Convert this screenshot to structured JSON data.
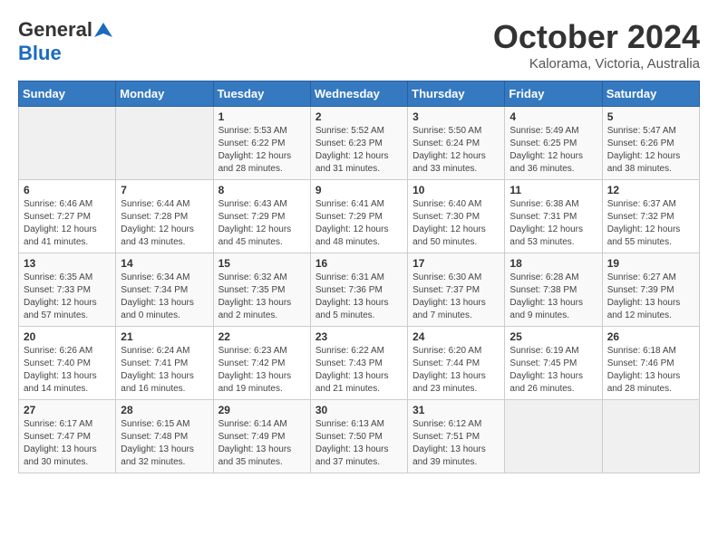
{
  "header": {
    "logo_general": "General",
    "logo_blue": "Blue",
    "month": "October 2024",
    "location": "Kalorama, Victoria, Australia"
  },
  "columns": [
    "Sunday",
    "Monday",
    "Tuesday",
    "Wednesday",
    "Thursday",
    "Friday",
    "Saturday"
  ],
  "weeks": [
    [
      {
        "day": "",
        "empty": true
      },
      {
        "day": "",
        "empty": true
      },
      {
        "day": "1",
        "sunrise": "5:53 AM",
        "sunset": "6:22 PM",
        "daylight": "12 hours and 28 minutes."
      },
      {
        "day": "2",
        "sunrise": "5:52 AM",
        "sunset": "6:23 PM",
        "daylight": "12 hours and 31 minutes."
      },
      {
        "day": "3",
        "sunrise": "5:50 AM",
        "sunset": "6:24 PM",
        "daylight": "12 hours and 33 minutes."
      },
      {
        "day": "4",
        "sunrise": "5:49 AM",
        "sunset": "6:25 PM",
        "daylight": "12 hours and 36 minutes."
      },
      {
        "day": "5",
        "sunrise": "5:47 AM",
        "sunset": "6:26 PM",
        "daylight": "12 hours and 38 minutes."
      }
    ],
    [
      {
        "day": "6",
        "sunrise": "6:46 AM",
        "sunset": "7:27 PM",
        "daylight": "12 hours and 41 minutes."
      },
      {
        "day": "7",
        "sunrise": "6:44 AM",
        "sunset": "7:28 PM",
        "daylight": "12 hours and 43 minutes."
      },
      {
        "day": "8",
        "sunrise": "6:43 AM",
        "sunset": "7:29 PM",
        "daylight": "12 hours and 45 minutes."
      },
      {
        "day": "9",
        "sunrise": "6:41 AM",
        "sunset": "7:29 PM",
        "daylight": "12 hours and 48 minutes."
      },
      {
        "day": "10",
        "sunrise": "6:40 AM",
        "sunset": "7:30 PM",
        "daylight": "12 hours and 50 minutes."
      },
      {
        "day": "11",
        "sunrise": "6:38 AM",
        "sunset": "7:31 PM",
        "daylight": "12 hours and 53 minutes."
      },
      {
        "day": "12",
        "sunrise": "6:37 AM",
        "sunset": "7:32 PM",
        "daylight": "12 hours and 55 minutes."
      }
    ],
    [
      {
        "day": "13",
        "sunrise": "6:35 AM",
        "sunset": "7:33 PM",
        "daylight": "12 hours and 57 minutes."
      },
      {
        "day": "14",
        "sunrise": "6:34 AM",
        "sunset": "7:34 PM",
        "daylight": "13 hours and 0 minutes."
      },
      {
        "day": "15",
        "sunrise": "6:32 AM",
        "sunset": "7:35 PM",
        "daylight": "13 hours and 2 minutes."
      },
      {
        "day": "16",
        "sunrise": "6:31 AM",
        "sunset": "7:36 PM",
        "daylight": "13 hours and 5 minutes."
      },
      {
        "day": "17",
        "sunrise": "6:30 AM",
        "sunset": "7:37 PM",
        "daylight": "13 hours and 7 minutes."
      },
      {
        "day": "18",
        "sunrise": "6:28 AM",
        "sunset": "7:38 PM",
        "daylight": "13 hours and 9 minutes."
      },
      {
        "day": "19",
        "sunrise": "6:27 AM",
        "sunset": "7:39 PM",
        "daylight": "13 hours and 12 minutes."
      }
    ],
    [
      {
        "day": "20",
        "sunrise": "6:26 AM",
        "sunset": "7:40 PM",
        "daylight": "13 hours and 14 minutes."
      },
      {
        "day": "21",
        "sunrise": "6:24 AM",
        "sunset": "7:41 PM",
        "daylight": "13 hours and 16 minutes."
      },
      {
        "day": "22",
        "sunrise": "6:23 AM",
        "sunset": "7:42 PM",
        "daylight": "13 hours and 19 minutes."
      },
      {
        "day": "23",
        "sunrise": "6:22 AM",
        "sunset": "7:43 PM",
        "daylight": "13 hours and 21 minutes."
      },
      {
        "day": "24",
        "sunrise": "6:20 AM",
        "sunset": "7:44 PM",
        "daylight": "13 hours and 23 minutes."
      },
      {
        "day": "25",
        "sunrise": "6:19 AM",
        "sunset": "7:45 PM",
        "daylight": "13 hours and 26 minutes."
      },
      {
        "day": "26",
        "sunrise": "6:18 AM",
        "sunset": "7:46 PM",
        "daylight": "13 hours and 28 minutes."
      }
    ],
    [
      {
        "day": "27",
        "sunrise": "6:17 AM",
        "sunset": "7:47 PM",
        "daylight": "13 hours and 30 minutes."
      },
      {
        "day": "28",
        "sunrise": "6:15 AM",
        "sunset": "7:48 PM",
        "daylight": "13 hours and 32 minutes."
      },
      {
        "day": "29",
        "sunrise": "6:14 AM",
        "sunset": "7:49 PM",
        "daylight": "13 hours and 35 minutes."
      },
      {
        "day": "30",
        "sunrise": "6:13 AM",
        "sunset": "7:50 PM",
        "daylight": "13 hours and 37 minutes."
      },
      {
        "day": "31",
        "sunrise": "6:12 AM",
        "sunset": "7:51 PM",
        "daylight": "13 hours and 39 minutes."
      },
      {
        "day": "",
        "empty": true
      },
      {
        "day": "",
        "empty": true
      }
    ]
  ],
  "labels": {
    "sunrise": "Sunrise:",
    "sunset": "Sunset:",
    "daylight": "Daylight:"
  }
}
